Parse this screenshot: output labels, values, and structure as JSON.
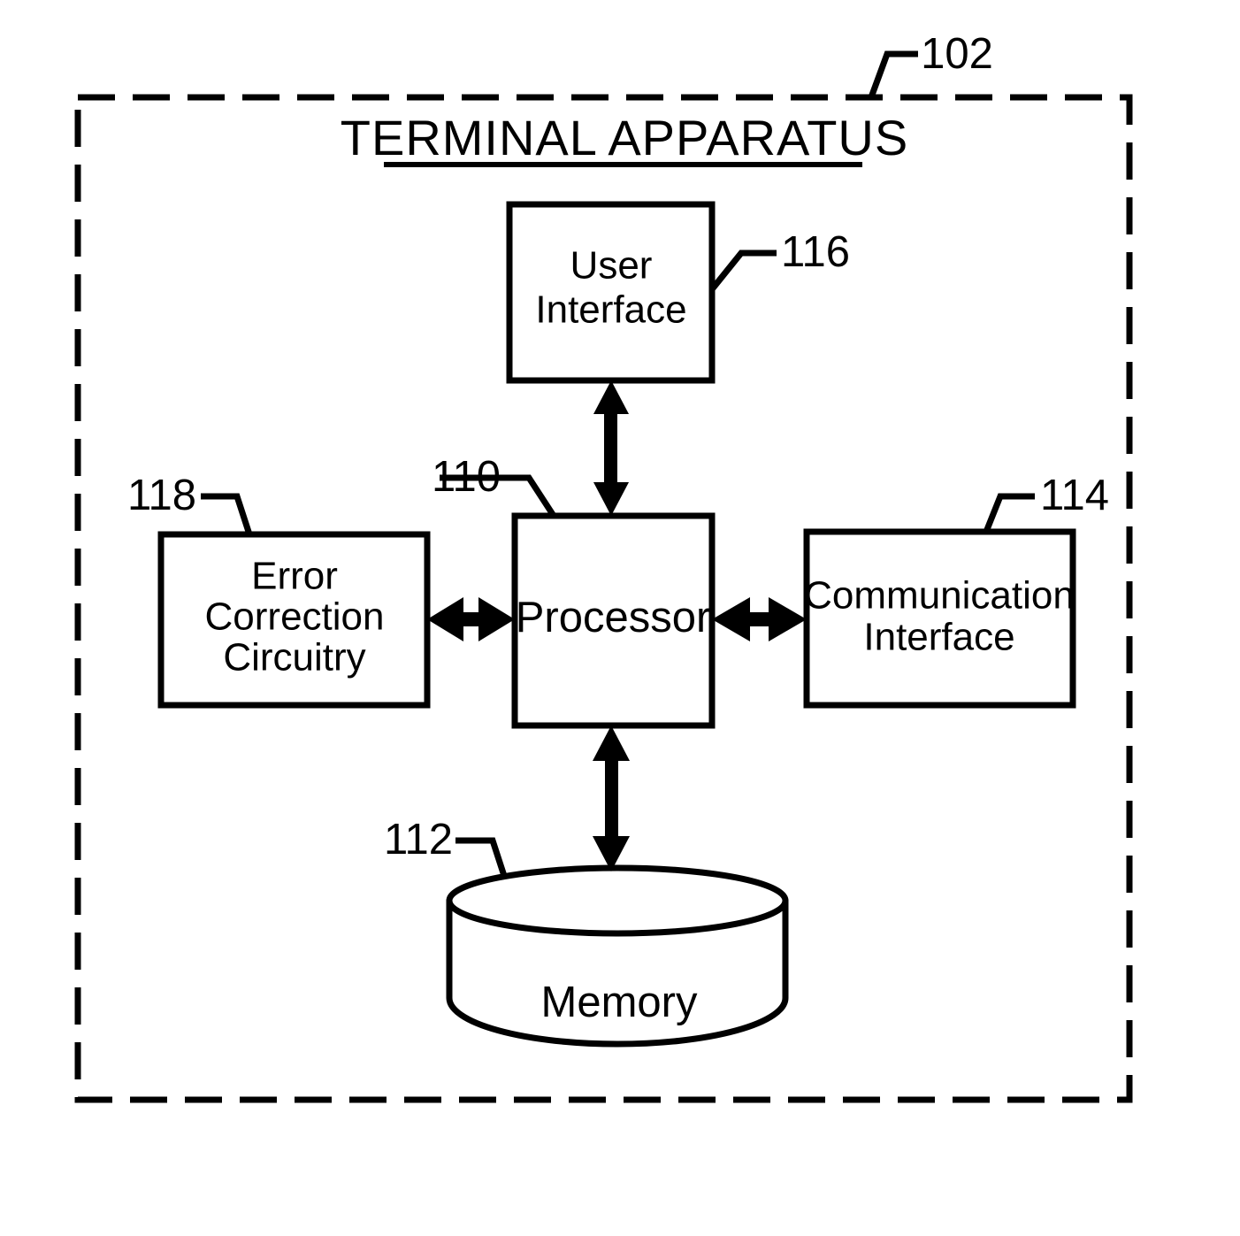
{
  "figure": {
    "title": "TERMINAL APPARATUS",
    "container_ref": "102"
  },
  "blocks": [
    {
      "id": "user-interface",
      "label_line1": "User",
      "label_line2": "Interface",
      "ref": "116",
      "shape": "rectangle"
    },
    {
      "id": "processor",
      "label_line1": "Processor",
      "label_line2": "",
      "ref": "110",
      "shape": "rectangle"
    },
    {
      "id": "error-correction-circuitry",
      "label_line1": "Error",
      "label_line2": "Correction",
      "label_line3": "Circuitry",
      "ref": "118",
      "shape": "rectangle"
    },
    {
      "id": "communication-interface",
      "label_line1": "Communication",
      "label_line2": "Interface",
      "ref": "114",
      "shape": "rectangle"
    },
    {
      "id": "memory",
      "label_line1": "Memory",
      "ref": "112",
      "shape": "cylinder"
    }
  ],
  "connections": [
    {
      "id": "ui-processor",
      "from": "user-interface",
      "to": "processor",
      "type": "bidirectional",
      "orientation": "vertical"
    },
    {
      "id": "ecc-processor",
      "from": "error-correction-circuitry",
      "to": "processor",
      "type": "bidirectional",
      "orientation": "horizontal"
    },
    {
      "id": "processor-comm",
      "from": "processor",
      "to": "communication-interface",
      "type": "bidirectional",
      "orientation": "horizontal"
    },
    {
      "id": "processor-memory",
      "from": "processor",
      "to": "memory",
      "type": "bidirectional",
      "orientation": "vertical"
    }
  ],
  "style": {
    "ink": "#000000",
    "paper": "#ffffff"
  }
}
